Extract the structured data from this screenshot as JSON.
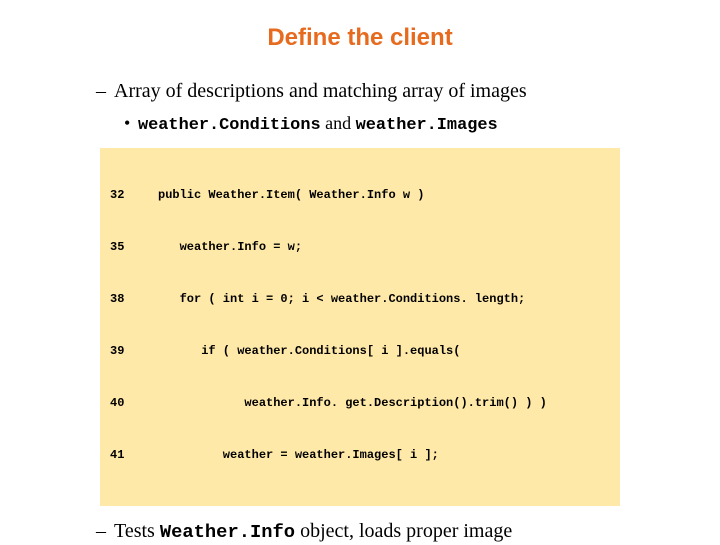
{
  "title": "Define the client",
  "bullet1": "Array of descriptions and matching array of images",
  "bullet2_prefix": "",
  "bullet2_code1": "weather.Conditions",
  "bullet2_mid": " and ",
  "bullet2_code2": "weather.Images",
  "code": {
    "lines": [
      {
        "num": "32",
        "text": "public Weather.Item( Weather.Info w )"
      },
      {
        "num": "35",
        "text": "   weather.Info = w;"
      },
      {
        "num": "38",
        "text": "   for ( int i = 0; i < weather.Conditions. length;"
      },
      {
        "num": "39",
        "text": "      if ( weather.Conditions[ i ].equals("
      },
      {
        "num": "40",
        "text": "            weather.Info. get.Description().trim() ) )"
      },
      {
        "num": "41",
        "text": "         weather = weather.Images[ i ];"
      }
    ]
  },
  "bullet3_prefix": "Tests ",
  "bullet3_code": "Weather.Info",
  "bullet3_suffix": " object, loads proper image"
}
